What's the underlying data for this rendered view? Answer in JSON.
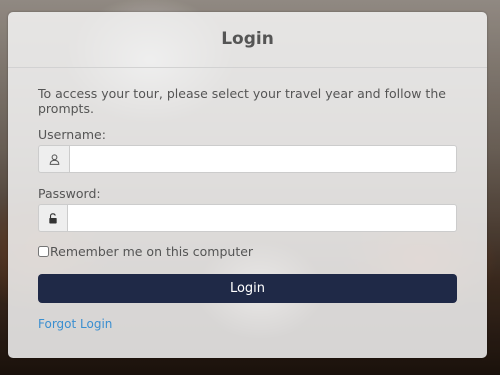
{
  "card": {
    "title": "Login",
    "intro": "To access your tour, please select your travel year and follow the prompts."
  },
  "username": {
    "label": "Username:",
    "icon": "user-icon",
    "value": "",
    "placeholder": ""
  },
  "password": {
    "label": "Password:",
    "icon": "lock-icon",
    "value": "",
    "placeholder": ""
  },
  "remember": {
    "label": "Remember me on this computer",
    "checked": false
  },
  "actions": {
    "login_label": "Login",
    "forgot_label": "Forgot Login"
  },
  "colors": {
    "button_bg": "#1f2947",
    "link": "#3a8fd0"
  }
}
